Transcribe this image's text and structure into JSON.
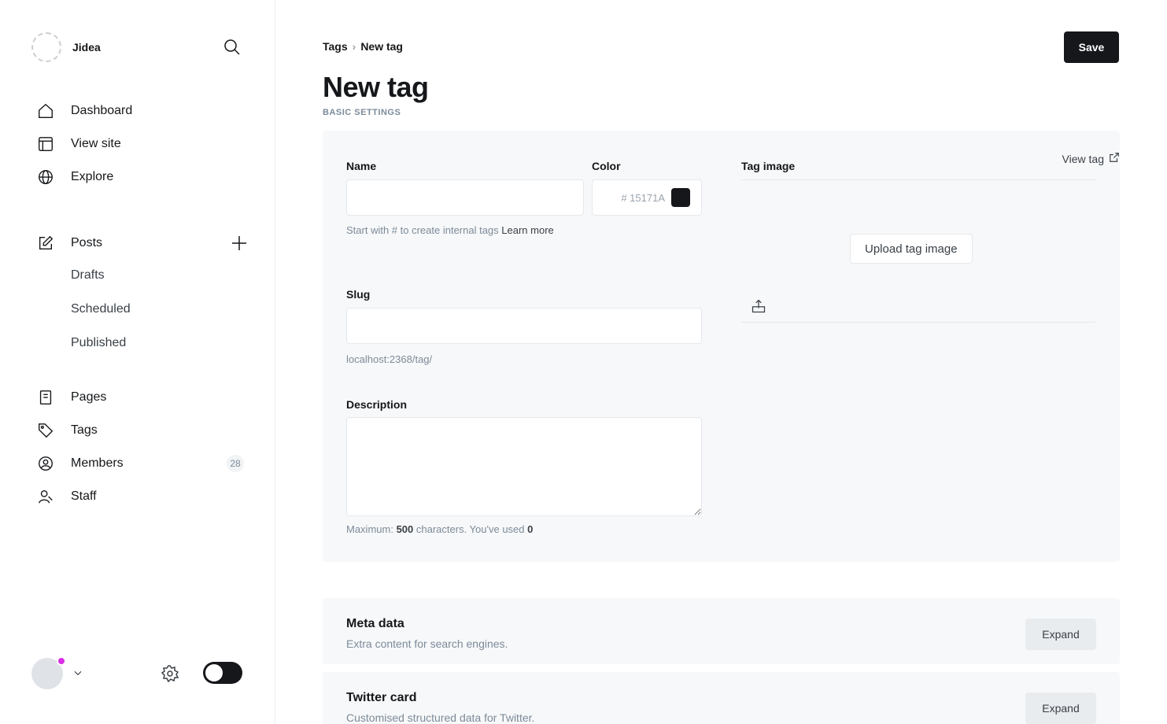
{
  "brand": {
    "name": "Jidea"
  },
  "sidebar": {
    "items": [
      {
        "label": "Dashboard",
        "icon": "home-icon"
      },
      {
        "label": "View site",
        "icon": "browser-icon"
      },
      {
        "label": "Explore",
        "icon": "globe-icon"
      },
      {
        "label": "Posts",
        "icon": "edit-icon"
      },
      {
        "label": "Pages",
        "icon": "page-icon"
      },
      {
        "label": "Tags",
        "icon": "tag-icon"
      },
      {
        "label": "Members",
        "icon": "members-icon",
        "count": "28"
      },
      {
        "label": "Staff",
        "icon": "staff-icon"
      }
    ],
    "post_subitems": [
      "Drafts",
      "Scheduled",
      "Published"
    ]
  },
  "header": {
    "breadcrumb_parent": "Tags",
    "breadcrumb_sep": "›",
    "breadcrumb_current": "New tag",
    "title": "New tag",
    "save_label": "Save"
  },
  "basic": {
    "section_heading": "BASIC SETTINGS",
    "name_label": "Name",
    "name_value": "",
    "color_label": "Color",
    "color_value": "# 15171A",
    "color_swatch": "#15171A",
    "name_hint": "Start with # to create internal tags",
    "name_hint_link": "Learn more",
    "slug_label": "Slug",
    "slug_value": "",
    "slug_hint": "localhost:2368/tag/",
    "desc_label": "Description",
    "desc_value": "",
    "desc_hint_prefix": "Maximum: ",
    "desc_hint_max": "500",
    "desc_hint_mid": " characters. You've used ",
    "desc_hint_used": "0",
    "tag_image_label": "Tag image",
    "view_tag_label": "View tag",
    "upload_label": "Upload tag image"
  },
  "meta": {
    "title": "Meta data",
    "subtitle": "Extra content for search engines.",
    "expand_label": "Expand"
  },
  "twitter": {
    "title": "Twitter card",
    "subtitle": "Customised structured data for Twitter.",
    "expand_label": "Expand"
  },
  "colors": {
    "accent": "#d92ee3",
    "ink": "#15171a",
    "panel": "#f7f8f9"
  }
}
